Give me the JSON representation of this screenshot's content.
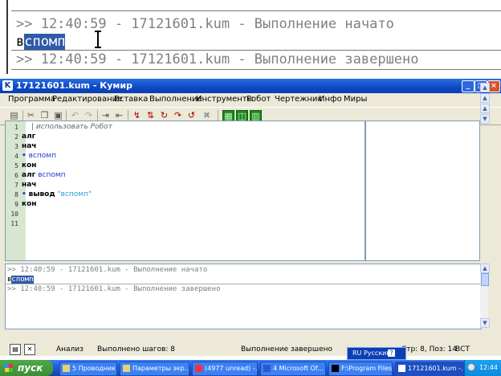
{
  "zoom": {
    "line1": ">> 12:40:59 - 17121601.kum - Выполнение начато",
    "line2_prefix": "в",
    "line2_highlight": "спомп",
    "line3": ">> 12:40:59 - 17121601.kum - Выполнение завершено"
  },
  "window": {
    "title": "17121601.kum - Кумир",
    "app_icon": "K",
    "minimize": "_",
    "maximize": "□",
    "close": "×"
  },
  "menu": [
    "Программа",
    "Редактирование",
    "Вставка",
    "Выполнение",
    "Инструменты",
    "Робот",
    "Чертежник",
    "Инфо",
    "Миры"
  ],
  "editor": {
    "line_numbers": [
      "1",
      "2",
      "3",
      "4",
      "5",
      "6",
      "7",
      "8",
      "9",
      "10",
      "11"
    ],
    "code": {
      "l1": "| использовать Робот",
      "l2": "алг",
      "l3": "нач",
      "l4_dot": "•",
      "l4": "вспомп",
      "l5": "кон",
      "l6_kw": "алг",
      "l6_id": "вспомп",
      "l7": "нач",
      "l8_dot": "•",
      "l8_kw": "вывод",
      "l8_str": "\"вспомп\"",
      "l9": "кон"
    }
  },
  "console": {
    "line1": ">> 12:40:59 - 17121601.kum - Выполнение начато",
    "line2_prefix": "в",
    "line2_highlight": "спомп",
    "line3": ">> 12:40:59 - 17121601.kum - Выполнение завершено"
  },
  "status": {
    "mode": "Анализ",
    "steps": "Выполнено шагов: 8",
    "state": "Выполнение завершено",
    "position": "Стр: 8, Поз: 14",
    "ins": "ВСТ"
  },
  "langbar": {
    "lang": "RU Русский",
    "help": "?"
  },
  "taskbar": {
    "start": "пуск",
    "tasks": [
      "5 Проводник",
      "Параметры экр...",
      "(4977 unread) -...",
      "4 Microsoft Of...",
      "F:\\Program Files...",
      "17121601.kum -..."
    ],
    "clock": "12:44"
  }
}
